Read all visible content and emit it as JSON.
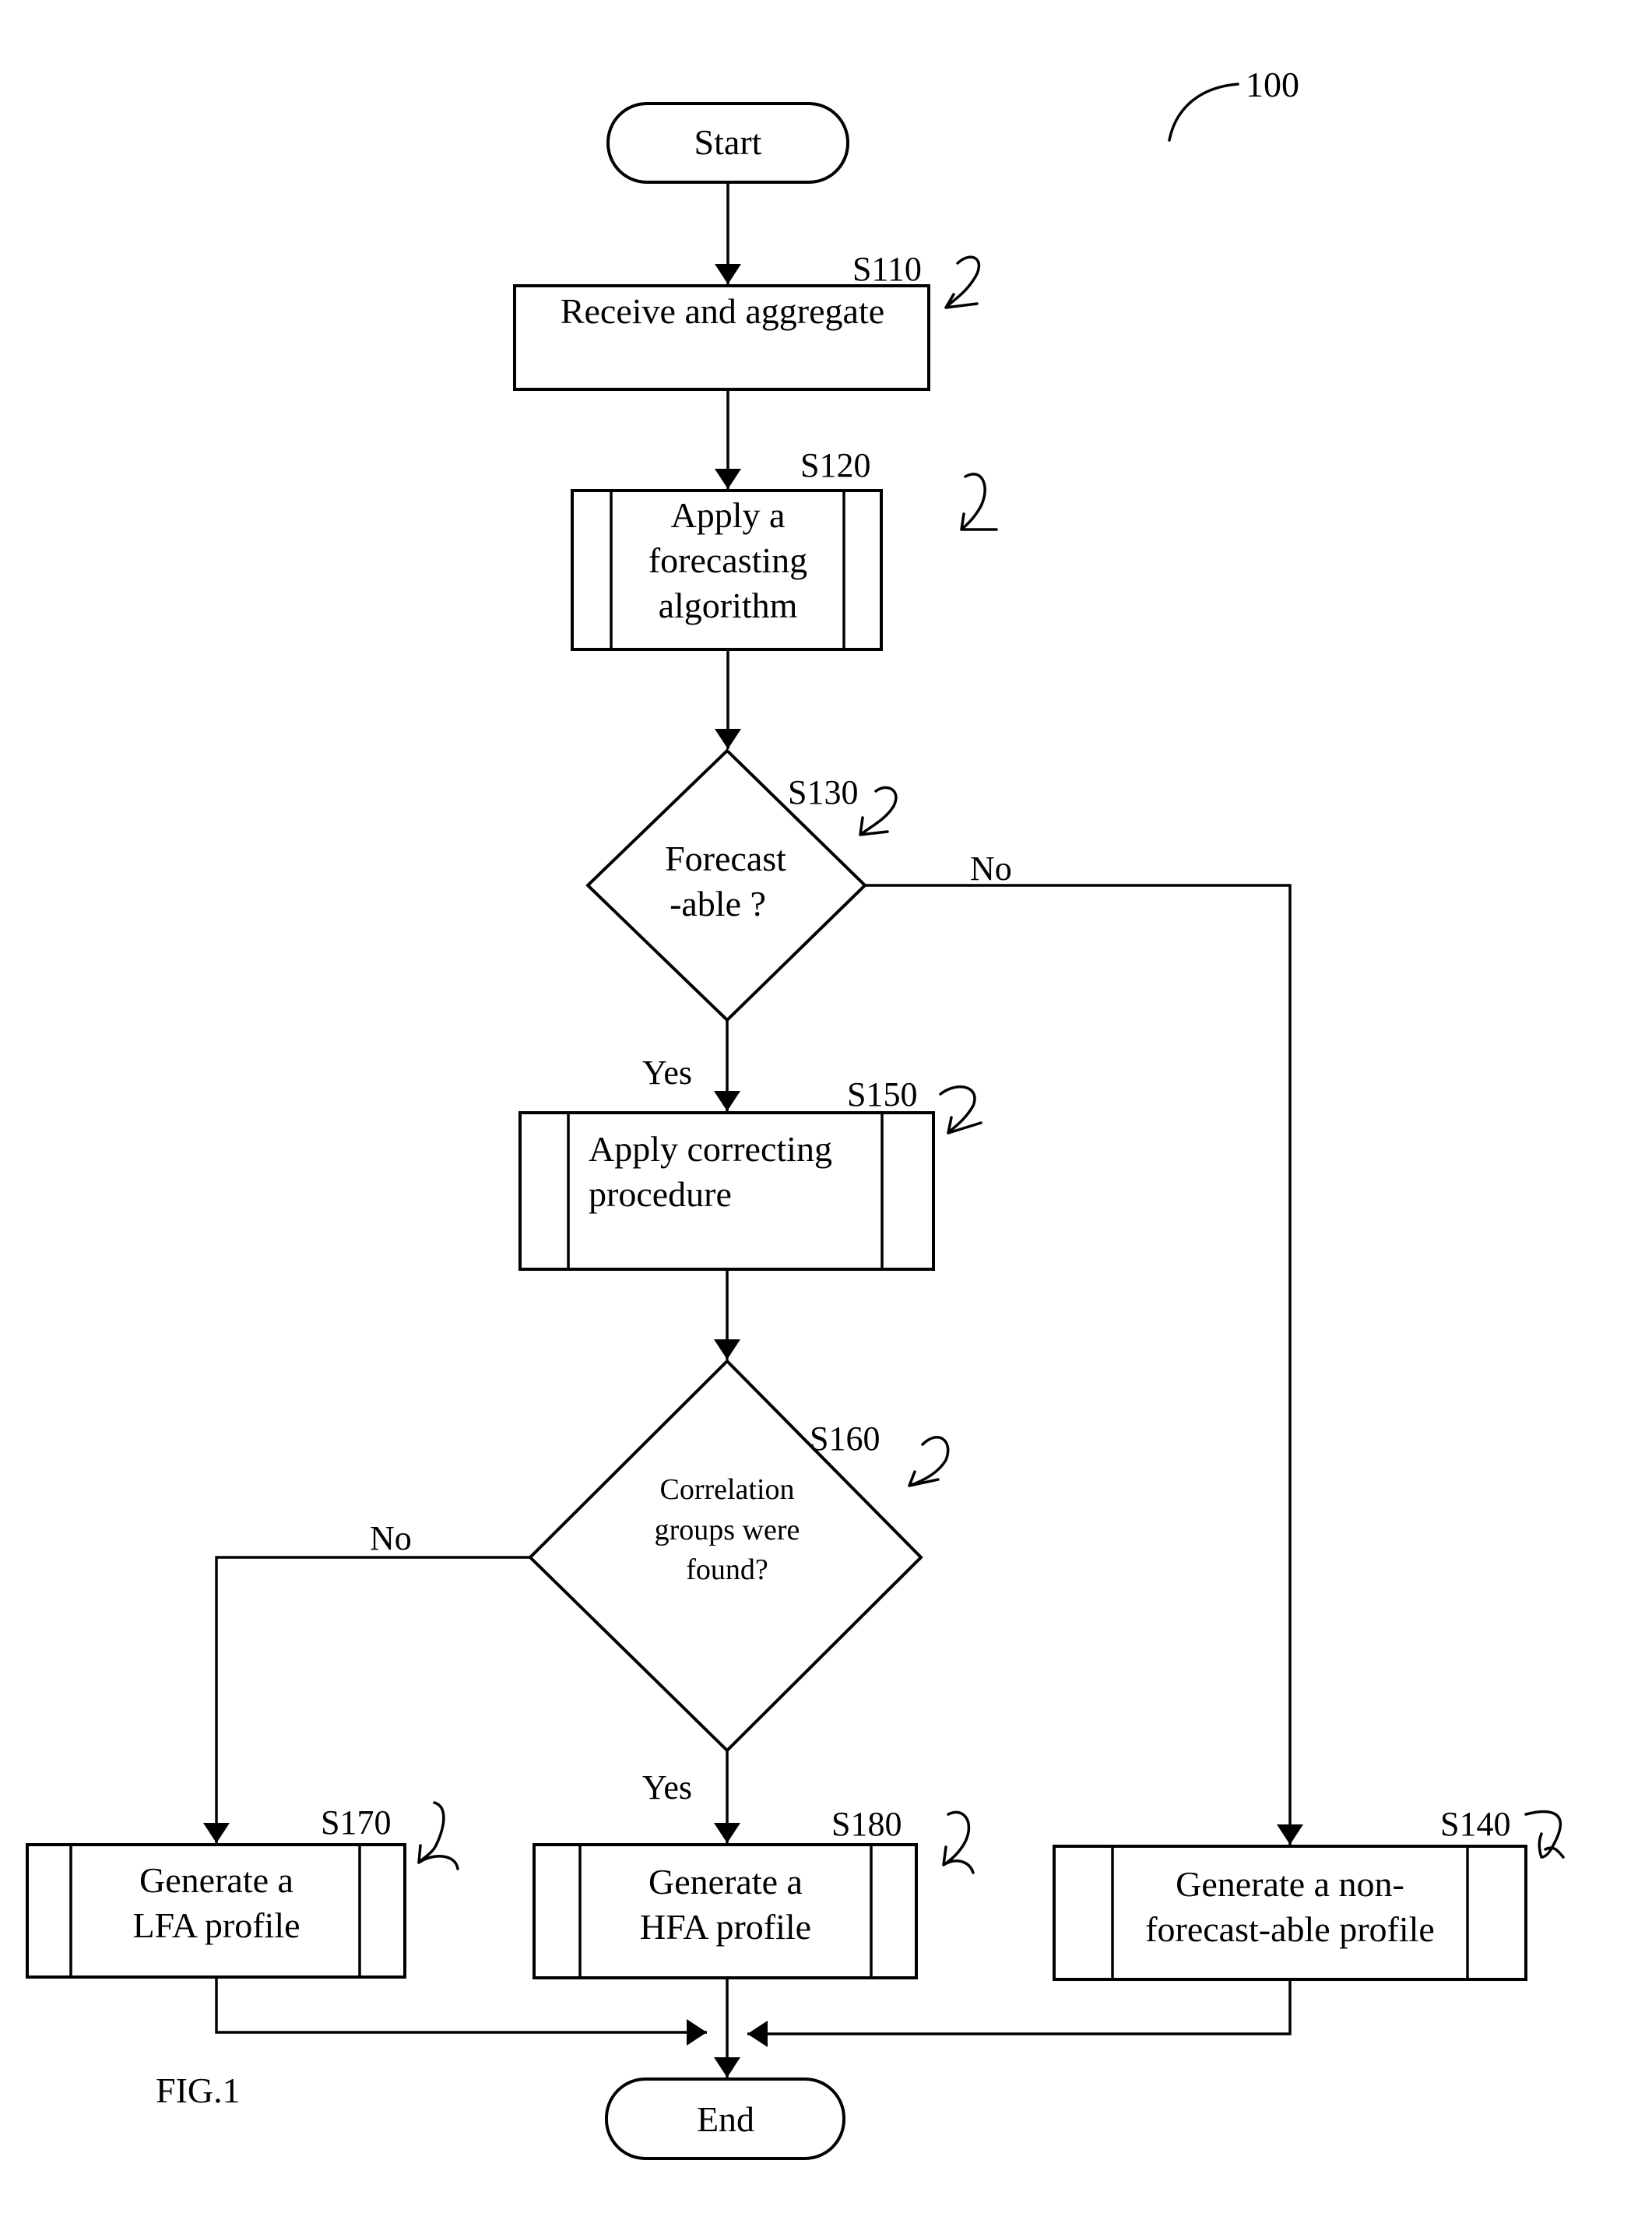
{
  "figure": {
    "reference_number": "100",
    "caption": "FIG.1"
  },
  "nodes": {
    "start": {
      "label": "Start"
    },
    "s110": {
      "step": "S110",
      "lines": [
        "Receive and aggregate"
      ]
    },
    "s120": {
      "step": "S120",
      "lines": [
        "Apply a",
        "forecasting",
        "algorithm"
      ]
    },
    "s130": {
      "step": "S130",
      "lines": [
        "Forecast",
        "-able ?"
      ]
    },
    "s150": {
      "step": "S150",
      "lines": [
        "Apply correcting",
        "procedure"
      ]
    },
    "s160": {
      "step": "S160",
      "lines": [
        "Correlation",
        "groups were",
        "found?"
      ]
    },
    "s170": {
      "step": "S170",
      "lines": [
        "Generate a",
        "LFA profile"
      ]
    },
    "s180": {
      "step": "S180",
      "lines": [
        "Generate a",
        "HFA profile"
      ]
    },
    "s140": {
      "step": "S140",
      "lines": [
        "Generate a non-",
        "forecast-able profile"
      ]
    },
    "end": {
      "label": "End"
    }
  },
  "edges": {
    "s130_no": "No",
    "s130_yes": "Yes",
    "s160_no": "No",
    "s160_yes": "Yes"
  }
}
